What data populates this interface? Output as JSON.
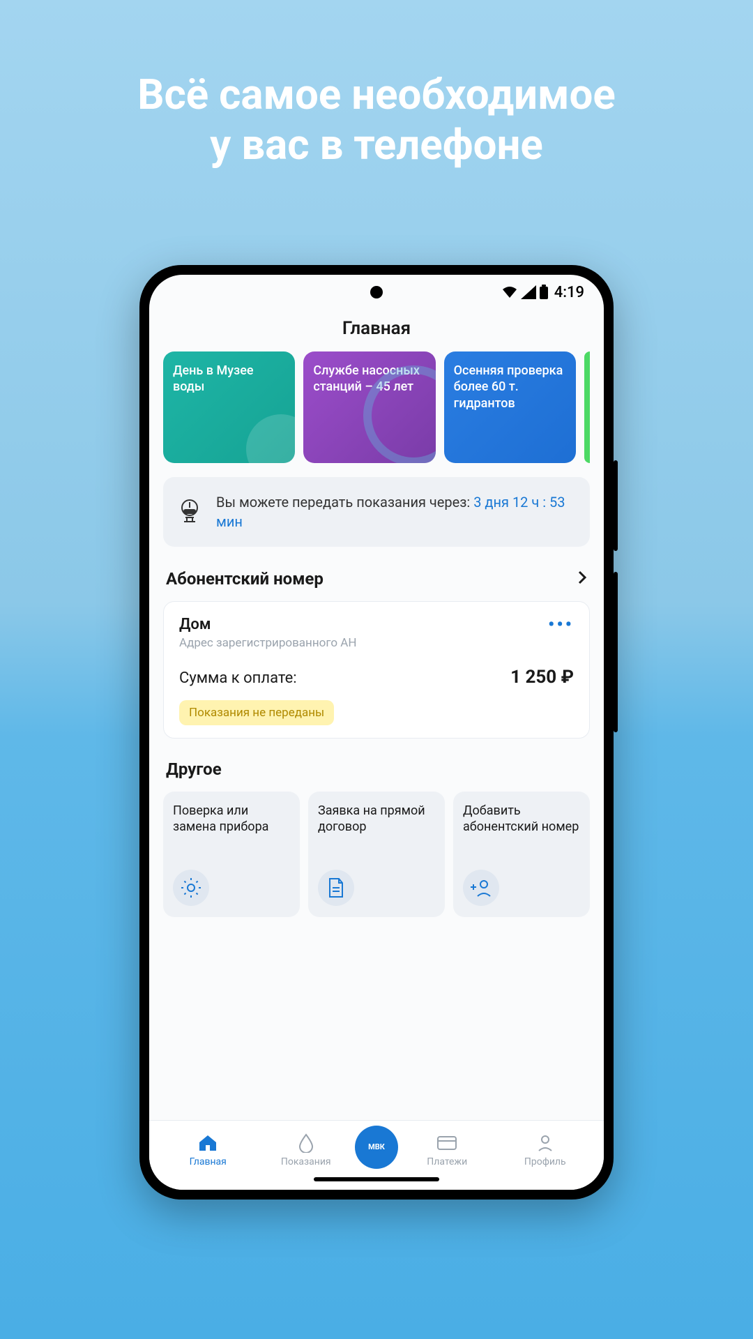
{
  "headline": {
    "line1": "Всё самое необходимое",
    "line2": "у вас в телефоне"
  },
  "status": {
    "time": "4:19"
  },
  "app": {
    "title": "Главная"
  },
  "news": [
    {
      "text": "День в Музее воды"
    },
    {
      "text": "Службе насосных станций – 45 лет"
    },
    {
      "text": "Осенняя проверка более 60 т. гидрантов"
    }
  ],
  "notice": {
    "prefix": "Вы можете передать показания через: ",
    "time": "3 дня 12 ч : 53 мин"
  },
  "sections": {
    "subscriber": "Абонентский номер",
    "other": "Другое"
  },
  "account": {
    "name": "Дом",
    "address": "Адрес зарегистрированного АН",
    "due_label": "Сумма к оплате:",
    "amount": "1 250 ₽",
    "badge": "Показания не переданы"
  },
  "tiles": [
    {
      "text": "Поверка или замена прибора"
    },
    {
      "text": "Заявка на прямой договор"
    },
    {
      "text": "Добавить абонентский номер"
    }
  ],
  "nav": {
    "home": "Главная",
    "readings": "Показания",
    "center": "МВК",
    "payments": "Платежи",
    "profile": "Профиль"
  }
}
